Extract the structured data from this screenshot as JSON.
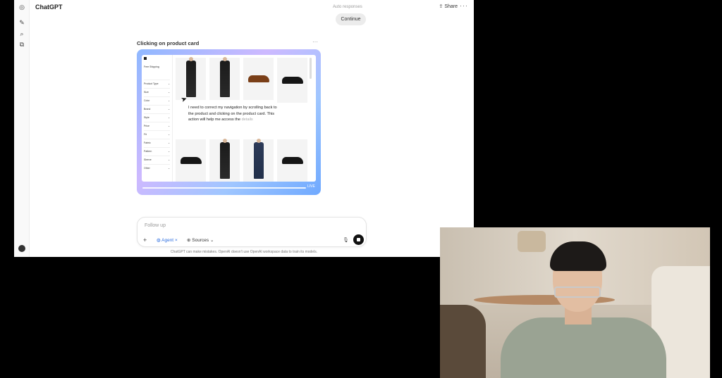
{
  "app": {
    "title": "ChatGPT",
    "share_label": "Share",
    "more_label": "···",
    "auto_responses": "Auto responses",
    "continue_label": "Continue"
  },
  "step": {
    "title": "Clicking on product card",
    "more_label": "···"
  },
  "preview": {
    "tooltip_main": "I need to correct my navigation by scrolling back to the product and clicking on the product card. This action will help me access the",
    "tooltip_fade": "details",
    "live_label": "LIVE",
    "filters": {
      "heading": "Free Shipping",
      "rows": [
        "Product Type",
        "Size",
        "Color",
        "Brand",
        "Style",
        "Price",
        "Fit",
        "Fabric",
        "Pattern",
        "Sleeve",
        "Other"
      ]
    }
  },
  "composer": {
    "placeholder": "Follow up",
    "agent_label": "Agent",
    "sources_label": "Sources"
  },
  "disclaimer": "ChatGPT can make mistakes. OpenAI doesn't use OpenAI workspace data to train its models."
}
